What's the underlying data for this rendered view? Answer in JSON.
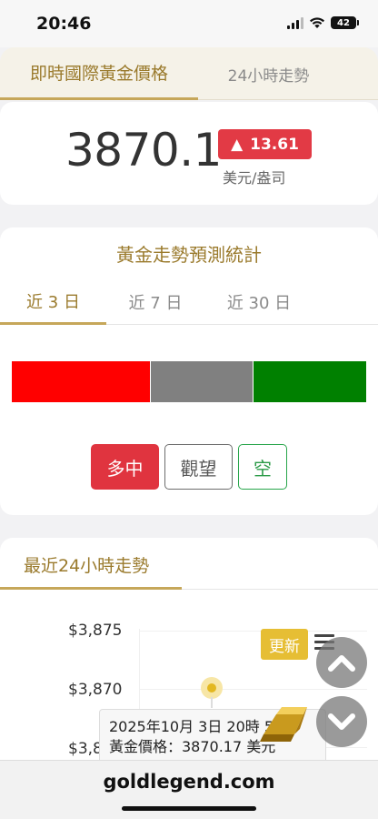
{
  "status_bar": {
    "time": "20:46",
    "battery": "42"
  },
  "tabs": {
    "active": "即時國際黃金價格",
    "inactive": "24小時走勢"
  },
  "price": {
    "value": "3870.17",
    "change_arrow": "▲",
    "change": "13.61",
    "unit": "美元/盎司",
    "change_color": "#e23a45"
  },
  "forecast": {
    "title": "黃金走勢預測統計",
    "periods": [
      "近 3 日",
      "近 7 日",
      "近 30 日"
    ],
    "active_period_index": 0,
    "distribution": [
      {
        "label": "多中",
        "share": 0.39,
        "color": "#ff0000"
      },
      {
        "label": "觀望",
        "share": 0.29,
        "color": "#808080"
      },
      {
        "label": "空",
        "share": 0.32,
        "color": "#008000"
      }
    ],
    "buttons": {
      "long": "多中",
      "wait": "觀望",
      "short": "空"
    }
  },
  "trend": {
    "title": "最近24小時走勢",
    "update_label": "更新",
    "menu_icon": "hamburger-menu-icon",
    "yticks": [
      "$3,875",
      "$3,870",
      "$3,8"
    ],
    "tooltip": {
      "line1": "2025年10月 3日 20時 5分",
      "line2": "黃金價格：3870.17 美元"
    }
  },
  "floating": {
    "up_icon": "chevron-up-icon",
    "down_icon": "chevron-down-icon"
  },
  "footer": {
    "url": "goldlegend.com"
  }
}
